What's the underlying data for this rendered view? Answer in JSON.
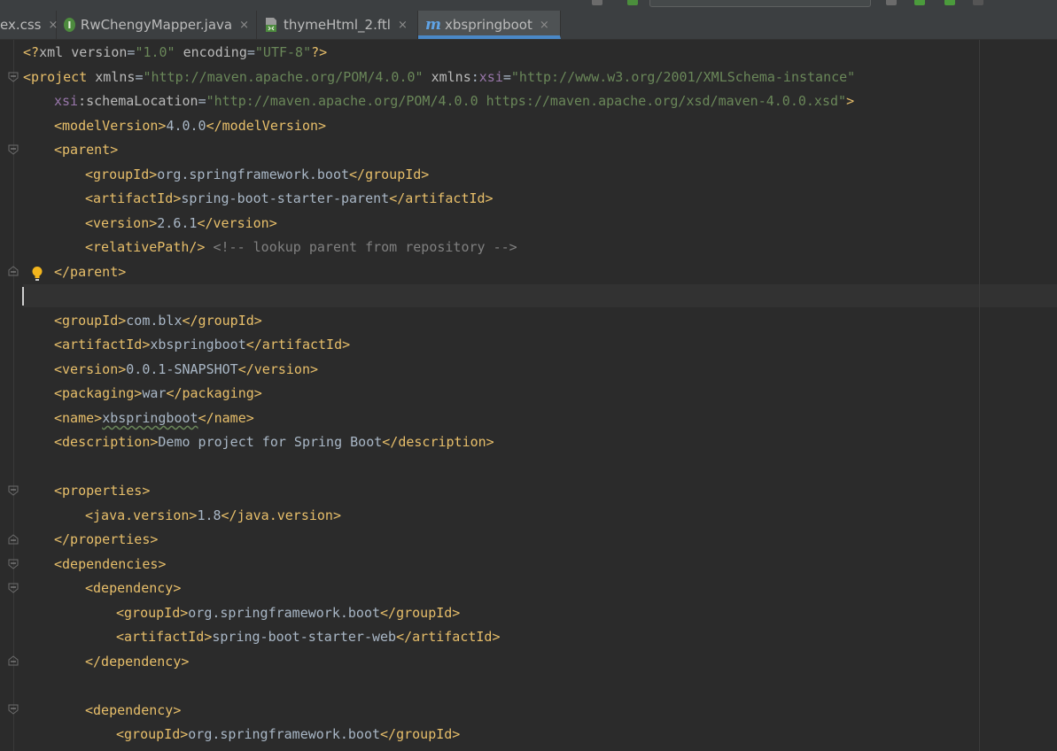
{
  "tabs": [
    {
      "label": "ex.css",
      "icon": "css-file-icon",
      "active": false
    },
    {
      "label": "RwChengyMapper.java",
      "icon": "interface-i-icon",
      "icon_letter": "I",
      "active": false
    },
    {
      "label": "thymeHtml_2.ftl",
      "icon": "ftl-file-icon",
      "active": false
    },
    {
      "label": "xbspringboot",
      "icon": "maven-m-icon",
      "icon_letter": "m",
      "active": true
    }
  ],
  "tab_close_glyph": "×",
  "colors": {
    "tag": "#e8bf6a",
    "attribute": "#bababa",
    "namespace": "#9876aa",
    "string": "#6a8759",
    "comment": "#808080",
    "text": "#a9b7c6",
    "background": "#2b2b2b",
    "tab_active_underline": "#4a88c7"
  },
  "code": {
    "l1": {
      "t1": "<?",
      "t2": "xml ",
      "a1": "version",
      "x1": "=",
      "v1": "\"1.0\"",
      "a2": " encoding",
      "x2": "=",
      "v2": "\"UTF-8\"",
      "t3": "?>"
    },
    "l2": {
      "t1": "<project ",
      "a1": "xmlns",
      "x1": "=",
      "v1": "\"http://maven.apache.org/POM/4.0.0\"",
      "a2": " xmlns",
      "x2": ":",
      "ns1": "xsi",
      "x3": "=",
      "v2": "\"http://www.w3.org/2001/XMLSchema-instance\""
    },
    "l3": {
      "ns1": "xsi",
      "a1": ":schemaLocation",
      "x1": "=",
      "v1": "\"http://maven.apache.org/POM/4.0.0 https://maven.apache.org/xsd/maven-4.0.0.xsd\"",
      "t1": ">"
    },
    "l4": {
      "o": "<modelVersion>",
      "val": "4.0.0",
      "c": "</modelVersion>"
    },
    "l5": {
      "o": "<parent>"
    },
    "l6": {
      "o": "<groupId>",
      "val": "org.springframework.boot",
      "c": "</groupId>"
    },
    "l7": {
      "o": "<artifactId>",
      "val": "spring-boot-starter-parent",
      "c": "</artifactId>"
    },
    "l8": {
      "o": "<version>",
      "val": "2.6.1",
      "c": "</version>"
    },
    "l9": {
      "o": "<relativePath/>",
      "cm": " <!-- lookup parent from repository -->"
    },
    "l10": {
      "c": "</parent>"
    },
    "l12": {
      "o": "<groupId>",
      "val": "com.blx",
      "c": "</groupId>"
    },
    "l13": {
      "o": "<artifactId>",
      "val": "xbspringboot",
      "c": "</artifactId>"
    },
    "l14": {
      "o": "<version>",
      "val": "0.0.1-SNAPSHOT",
      "c": "</version>"
    },
    "l15": {
      "o": "<packaging>",
      "val": "war",
      "c": "</packaging>"
    },
    "l16": {
      "o": "<name>",
      "val": "xbspringboot",
      "c": "</name>"
    },
    "l17": {
      "o": "<description>",
      "val": "Demo project for Spring Boot",
      "c": "</description>"
    },
    "l19": {
      "o": "<properties>"
    },
    "l20": {
      "o": "<java.version>",
      "val": "1.8",
      "c": "</java.version>"
    },
    "l21": {
      "c": "</properties>"
    },
    "l22": {
      "o": "<dependencies>"
    },
    "l23": {
      "o": "<dependency>"
    },
    "l24": {
      "o": "<groupId>",
      "val": "org.springframework.boot",
      "c": "</groupId>"
    },
    "l25": {
      "o": "<artifactId>",
      "val": "spring-boot-starter-web",
      "c": "</artifactId>"
    },
    "l26": {
      "c": "</dependency>"
    },
    "l28": {
      "o": "<dependency>"
    },
    "l29": {
      "o": "<groupId>",
      "val": "org.springframework.boot",
      "c": "</groupId>"
    }
  }
}
